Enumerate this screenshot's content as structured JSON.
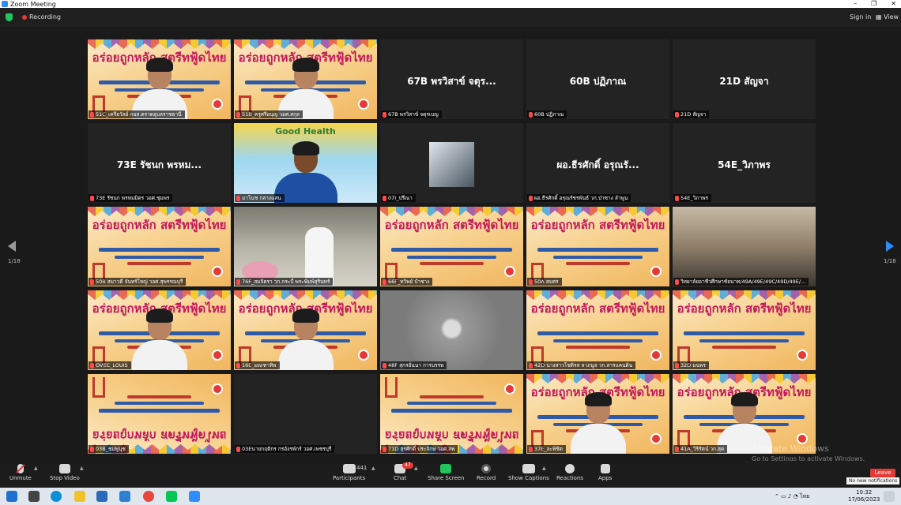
{
  "window": {
    "title": "Zoom Meeting",
    "controls": [
      "–",
      "❐",
      "✕"
    ]
  },
  "topbar": {
    "recording": "Recording",
    "sign_in": "Sign in",
    "view": "View"
  },
  "pager": {
    "left": "1/18",
    "right": "1/18"
  },
  "tiles": [
    {
      "name": "51C_เครือวัลย์ กอส.ตราดอุบลราชธานี",
      "kind": "poster-person"
    },
    {
      "name": "51B_ครูศรีอนุญ วอศ.สกุล",
      "kind": "poster-person"
    },
    {
      "name": "67B พรวิสาข์ จตุรเบญ",
      "kind": "camoff",
      "label": "67B พรวิสาข์ จตุร..."
    },
    {
      "name": "60B ปฏิภาณ",
      "kind": "camoff",
      "label": "60B ปฏิภาณ"
    },
    {
      "name": "21D สัญจา",
      "kind": "camoff",
      "label": "21D สัญจา"
    },
    {
      "name": "73E รัชนก พรหมมิตร วอศ.ชุมพร",
      "kind": "camoff",
      "label": "73E รัชนก พรหม..."
    },
    {
      "name": "มาโนช กลางแสน",
      "kind": "health",
      "speaking": true
    },
    {
      "name": "07I_ปรีณา",
      "kind": "photo"
    },
    {
      "name": "ผอ.ธีรศักดิ์ อรุณรัชรพันธ์ วก.ป่าซาง ลำพูน",
      "kind": "camoff",
      "label": "ผอ.ธีรศักดิ์ อรุณรั..."
    },
    {
      "name": "54E_วิภาพร",
      "kind": "camoff",
      "label": "54E_วิภาพร"
    },
    {
      "name": "50B สมาวดี จันทร์ใหญ่ วอศ.สุพรรณบุรี",
      "kind": "poster"
    },
    {
      "name": "76F_สมจิตรา วก.กระบี่ พระพิมพ์สุรินทร์",
      "kind": "ceremony"
    },
    {
      "name": "66F_ทวิพย์ ปำชาง",
      "kind": "poster"
    },
    {
      "name": "50A สมศร",
      "kind": "poster"
    },
    {
      "name": "วิทยาลัยอาชีวศึกษาชัยนาท/49A/49E/49C/49D/49E/...",
      "kind": "meeting"
    },
    {
      "name": "OVEC_LOUIS",
      "kind": "poster-person"
    },
    {
      "name": "16E_มณฑาทิพ",
      "kind": "poster-person"
    },
    {
      "name": "48F สุกรอั่นนา การบรรพ",
      "kind": "blur"
    },
    {
      "name": "42D นางสาวโชติรส ลาภมูล วก.สารแคนดิน",
      "kind": "poster"
    },
    {
      "name": "32D มนพร",
      "kind": "poster"
    },
    {
      "name": "03B_ชมพูนุช",
      "kind": "poster-flip"
    },
    {
      "name": "03Eนายกฤติกร กรอังรพักร์ วอศ.เพชรบุรี",
      "kind": "camoff",
      "label": ""
    },
    {
      "name": "71D สุรศักดิ์ ประจักษ วอศ.ลพ",
      "kind": "poster-flip"
    },
    {
      "name": "37E_ละพิชิต",
      "kind": "poster-person"
    },
    {
      "name": "41A_วิริรัตน์ วก.สุด",
      "kind": "poster-person"
    }
  ],
  "poster_title": "อร่อยถูกหลัก สตรีทฟู้ดไทย",
  "health_banner": "Good Health",
  "toolbar": {
    "unmute": "Unmute",
    "stop_video": "Stop Video",
    "participants": "Participants",
    "participants_count": "441",
    "chat": "Chat",
    "chat_badge": "47",
    "share_screen": "Share Screen",
    "record": "Record",
    "show_captions": "Show Captions",
    "reactions": "Reactions",
    "apps": "Apps",
    "leave": "Leave"
  },
  "watermark": {
    "line1": "Activate Windows",
    "line2": "Go to Settings to activate Windows."
  },
  "notification": "No new notifications",
  "taskbar": {
    "time": "10:32",
    "date": "17/06/2023",
    "lang": "ไทย"
  },
  "colors": {
    "accent": "#2d8cff",
    "speaking_border": "#9bd33a",
    "leave": "#e53935",
    "share": "#22c55e"
  }
}
